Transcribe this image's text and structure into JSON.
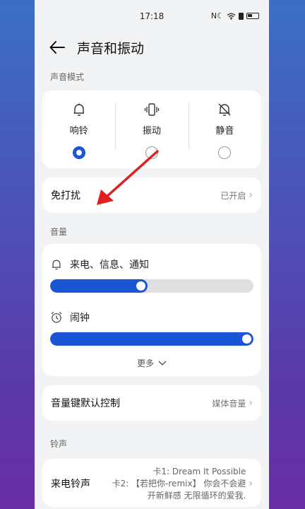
{
  "status_bar": {
    "time": "17:18",
    "icons": "N☾"
  },
  "header": {
    "title": "声音和振动"
  },
  "sound_mode": {
    "section_label": "声音模式",
    "modes": [
      {
        "label": "响铃",
        "icon": "bell-icon",
        "selected": true
      },
      {
        "label": "振动",
        "icon": "vibrate-icon",
        "selected": false
      },
      {
        "label": "静音",
        "icon": "bell-off-icon",
        "selected": false
      }
    ]
  },
  "dnd": {
    "title": "免打扰",
    "value": "已开启"
  },
  "volume": {
    "section_label": "音量",
    "items": [
      {
        "label": "来电、信息、通知",
        "icon": "bell-icon",
        "level": 0.48
      },
      {
        "label": "闹钟",
        "icon": "alarm-clock-icon",
        "level": 1.0
      }
    ],
    "more_label": "更多"
  },
  "volume_key": {
    "title": "音量键默认控制",
    "value": "媒体音量"
  },
  "ringtone": {
    "section_label": "铃声",
    "title": "来电铃声",
    "lines": [
      "卡1: Dream It Possible",
      "卡2: 【若把你-remix】 你会不会避",
      "开新鲜感 无限循环的爱我."
    ]
  },
  "annotation": {
    "color": "#e02020"
  }
}
